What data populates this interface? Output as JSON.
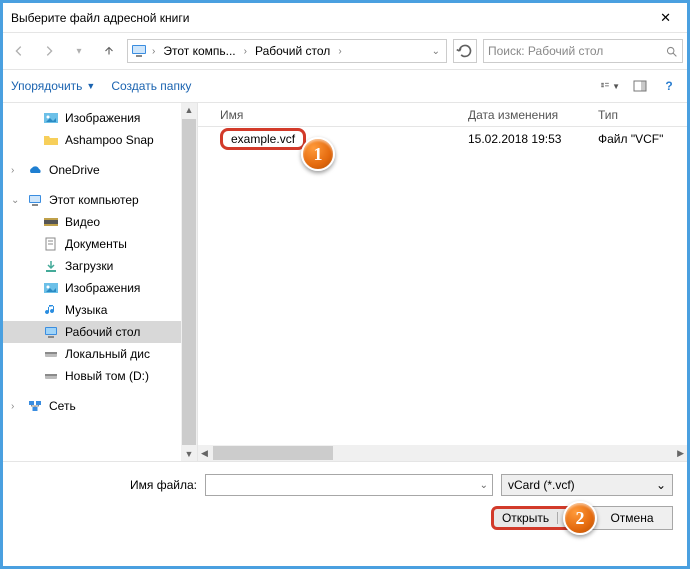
{
  "title": "Выберите файл адресной книги",
  "breadcrumb": {
    "seg1": "Этот компь...",
    "seg2": "Рабочий стол"
  },
  "search": {
    "placeholder": "Поиск: Рабочий стол"
  },
  "toolbar": {
    "organize": "Упорядочить",
    "newfolder": "Создать папку"
  },
  "tree": {
    "items": [
      {
        "label": "Изображения",
        "icon": "pictures"
      },
      {
        "label": "Ashampoo Snap",
        "icon": "folder"
      },
      {
        "label": "OneDrive",
        "icon": "onedrive"
      },
      {
        "label": "Этот компьютер",
        "icon": "thispc"
      },
      {
        "label": "Видео",
        "icon": "videos"
      },
      {
        "label": "Документы",
        "icon": "documents"
      },
      {
        "label": "Загрузки",
        "icon": "downloads"
      },
      {
        "label": "Изображения",
        "icon": "pictures"
      },
      {
        "label": "Музыка",
        "icon": "music"
      },
      {
        "label": "Рабочий стол",
        "icon": "desktop"
      },
      {
        "label": "Локальный дис",
        "icon": "drive"
      },
      {
        "label": "Новый том (D:)",
        "icon": "drive"
      },
      {
        "label": "Сеть",
        "icon": "network"
      }
    ]
  },
  "list": {
    "columns": {
      "name": "Имя",
      "date": "Дата изменения",
      "type": "Тип"
    },
    "rows": [
      {
        "name": "example.vcf",
        "date": "15.02.2018 19:53",
        "type": "Файл \"VCF\""
      }
    ]
  },
  "footer": {
    "filename_label": "Имя файла:",
    "filename_value": "",
    "filter": "vCard (*.vcf)",
    "open": "Открыть",
    "cancel": "Отмена"
  },
  "callouts": {
    "c1": "1",
    "c2": "2"
  }
}
